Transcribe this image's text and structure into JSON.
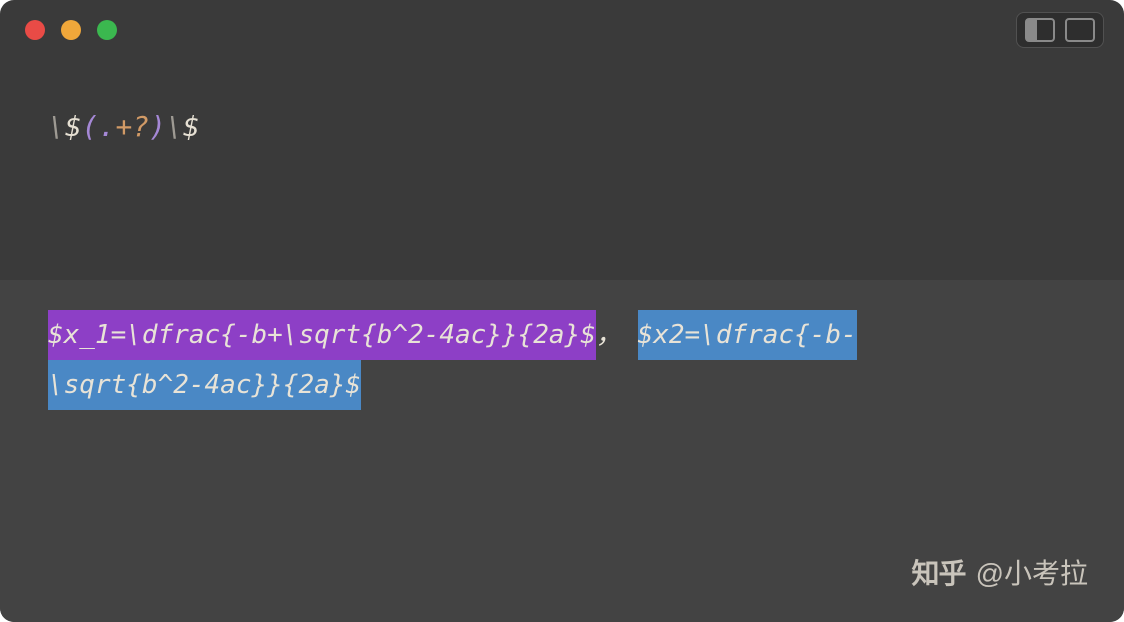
{
  "titlebar": {
    "buttons": {
      "close": "close",
      "minimize": "minimize",
      "zoom": "zoom"
    }
  },
  "regex": {
    "tokens": [
      {
        "cls": "escape",
        "text": "\\"
      },
      {
        "cls": "literal",
        "text": "$"
      },
      {
        "cls": "paren",
        "text": "("
      },
      {
        "cls": "dot",
        "text": "."
      },
      {
        "cls": "quant",
        "text": "+?"
      },
      {
        "cls": "paren",
        "text": ")"
      },
      {
        "cls": "escape",
        "text": "\\"
      },
      {
        "cls": "literal",
        "text": "$"
      }
    ]
  },
  "test": {
    "match1": "$x_1=\\dfrac{-b+\\sqrt{b^2-4ac}}{2a}$",
    "separator": "，",
    "match2_line1": "$x2=\\dfrac{-b-",
    "match2_line2": "\\sqrt{b^2-4ac}}{2a}$"
  },
  "watermark": {
    "logo": "知乎",
    "author": "@小考拉"
  }
}
